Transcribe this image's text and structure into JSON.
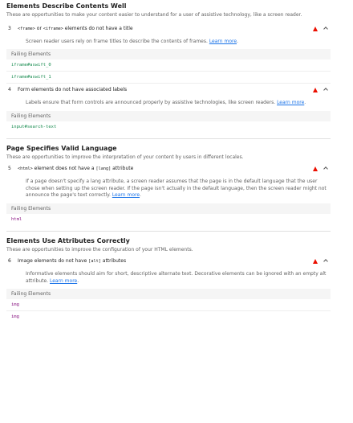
{
  "sections": [
    {
      "title": "Elements Describe Contents Well",
      "desc": "These are opportunities to make your content easier to understand for a user of assistive technology, like a screen reader."
    },
    {
      "title": "Page Specifies Valid Language",
      "desc": "These are opportunities to improve the interpretation of your content by users in different locales."
    },
    {
      "title": "Elements Use Attributes Correctly",
      "desc": "These are opportunities to improve the configuration of your HTML elements."
    }
  ],
  "audits": {
    "a3": {
      "num": "3",
      "code1": "<frame>",
      "or": " or ",
      "code2": "<iframe>",
      "rest": " elements do not have a title",
      "body": "Screen reader users rely on frame titles to describe the contents of frames. ",
      "link": "Learn more",
      "tail": ".",
      "failing_label": "Failing Elements",
      "items": [
        "iframe#aswift_0",
        "iframe#aswift_1"
      ]
    },
    "a4": {
      "num": "4",
      "title": "Form elements do not have associated labels",
      "body": "Labels ensure that form controls are announced properly by assistive technologies, like screen readers. ",
      "link": "Learn more",
      "tail": ".",
      "failing_label": "Failing Elements",
      "items": [
        "input#search-text"
      ]
    },
    "a5": {
      "num": "5",
      "code1": "<html>",
      "mid": " element does not have a ",
      "code2": "[lang]",
      "rest": " attribute",
      "body": "If a page doesn't specify a lang attribute, a screen reader assumes that the page is in the default language that the user chose when setting up the screen reader. If the page isn't actually in the default language, then the screen reader might not announce the page's text correctly. ",
      "link": "Learn more",
      "tail": ".",
      "failing_label": "Failing Elements",
      "items": [
        "html"
      ]
    },
    "a6": {
      "num": "6",
      "title_pre": "Image elements do not have ",
      "code": "[alt]",
      "rest": " attributes",
      "body": "Informative elements should aim for short, descriptive alternate text. Decorative elements can be ignored with an empty alt attribute. ",
      "link": "Learn more",
      "tail": ".",
      "failing_label": "Failing Elements",
      "items": [
        "img",
        "img"
      ]
    }
  },
  "colors": {
    "fail_red": "#eb0f00",
    "link_blue": "#1a73e8",
    "node_purple": "#881280",
    "node_green": "#1a8d51"
  },
  "icons": {
    "fail": "warning-triangle-icon",
    "toggle": "chevron-up-icon"
  }
}
